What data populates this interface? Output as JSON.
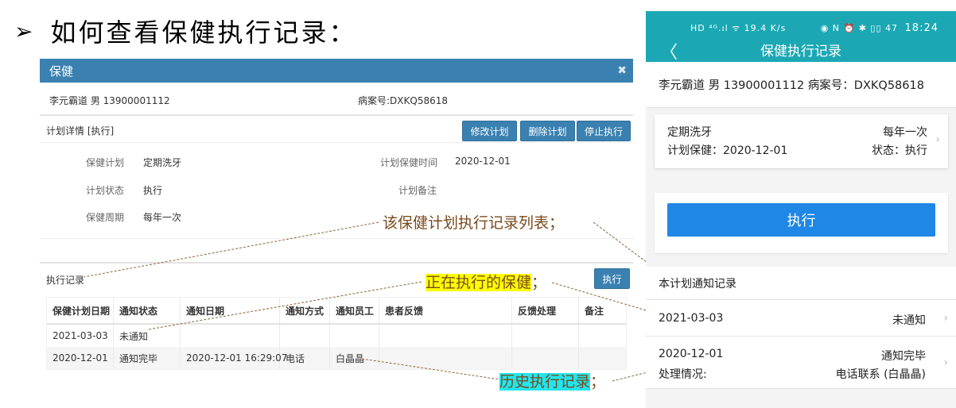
{
  "slide": {
    "bullet": "➢",
    "title": "如何查看保健执行记录："
  },
  "modal": {
    "title": "保健",
    "close": "✖",
    "patient": "李元霸道 男 13900001112",
    "record_no": "病案号:DXKQ58618",
    "detail_label": "计划详情 [执行]",
    "buttons": {
      "edit": "修改计划",
      "delete": "删除计划",
      "stop": "停止执行",
      "execute": "执行"
    },
    "fields": {
      "plan_key": "保健计划",
      "plan_val": "定期洗牙",
      "status_key": "计划状态",
      "status_val": "执行",
      "cycle_key": "保健周期",
      "cycle_val": "每年一次",
      "time_key": "计划保健时间",
      "time_val": "2020-12-01",
      "note_key": "计划备注"
    },
    "records_label": "执行记录",
    "table": {
      "headers": [
        "保健计划日期",
        "通知状态",
        "通知日期",
        "通知方式",
        "通知员工",
        "患者反馈",
        "反馈处理",
        "备注"
      ],
      "rows": [
        [
          "2021-03-03",
          "未通知",
          "",
          "",
          "",
          "",
          "",
          ""
        ],
        [
          "2020-12-01",
          "通知完毕",
          "2020-12-01 16:29:07",
          "电话",
          "白晶晶",
          "",
          "",
          ""
        ]
      ]
    }
  },
  "annotations": {
    "list": "该保健计划执行记录列表",
    "list_sep": "；",
    "current": "正在执行的保健",
    "current_sep": "；",
    "history": "历史执行记录",
    "history_sep": "；"
  },
  "phone": {
    "status_left": "HD ⁴ᴳ.ıl ᯤ 19.4 K/s",
    "status_right": "◉ N ⏰ ✱ ▯▯ 47",
    "time": "18:24",
    "back": "〈",
    "title": "保健执行记录",
    "patient": "李元霸道  男 13900001112   病案号：DXKQ58618",
    "card": {
      "name": "定期洗牙",
      "cycle": "每年一次",
      "plan_date": "计划保健：2020-12-01",
      "status": "状态：执行"
    },
    "execute": "执行",
    "section": "本计划通知记录",
    "items": [
      {
        "date": "2021-03-03",
        "status": "未通知"
      },
      {
        "date": "2020-12-01",
        "status": "通知完毕",
        "sub_label": "处理情况:",
        "detail": "电话联系 (白晶晶)"
      }
    ],
    "chevron": "›"
  },
  "colors": {
    "header_blue": "#3a81b1",
    "phone_teal": "#1ba8b4",
    "execute_blue": "#1f87e5",
    "highlight_yellow": "#ffff00",
    "highlight_cyan": "#22e5ee"
  }
}
